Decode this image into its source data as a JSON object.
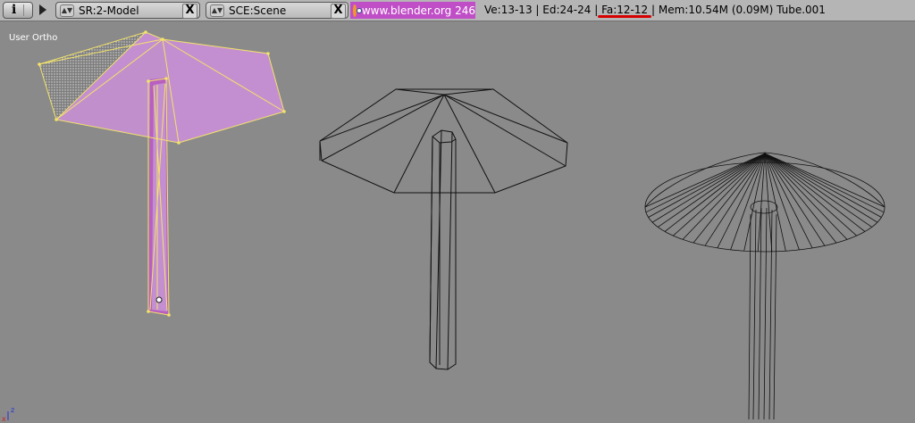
{
  "header": {
    "screen_menu": "SR:2-Model",
    "scene_menu": "SCE:Scene",
    "version": "www.blender.org 246",
    "stats": {
      "vertices": "Ve:13-13",
      "edges": "Ed:24-24",
      "faces": "Fa:12-12",
      "memory": "Mem:10.54M (0.09M)",
      "object": "Tube.001"
    },
    "close_glyph": "X"
  },
  "viewport": {
    "label": "User Ortho",
    "axis_x": "x",
    "axis_z": "z"
  },
  "colors": {
    "background": "#8a8a8a",
    "selection": "#c48fd0",
    "edge_highlight": "#f3e36a",
    "annotation": "#d60000"
  },
  "icons": [
    "info-icon",
    "triangle-icon",
    "dropdown-icon",
    "close-icon",
    "blender-logo-icon"
  ]
}
